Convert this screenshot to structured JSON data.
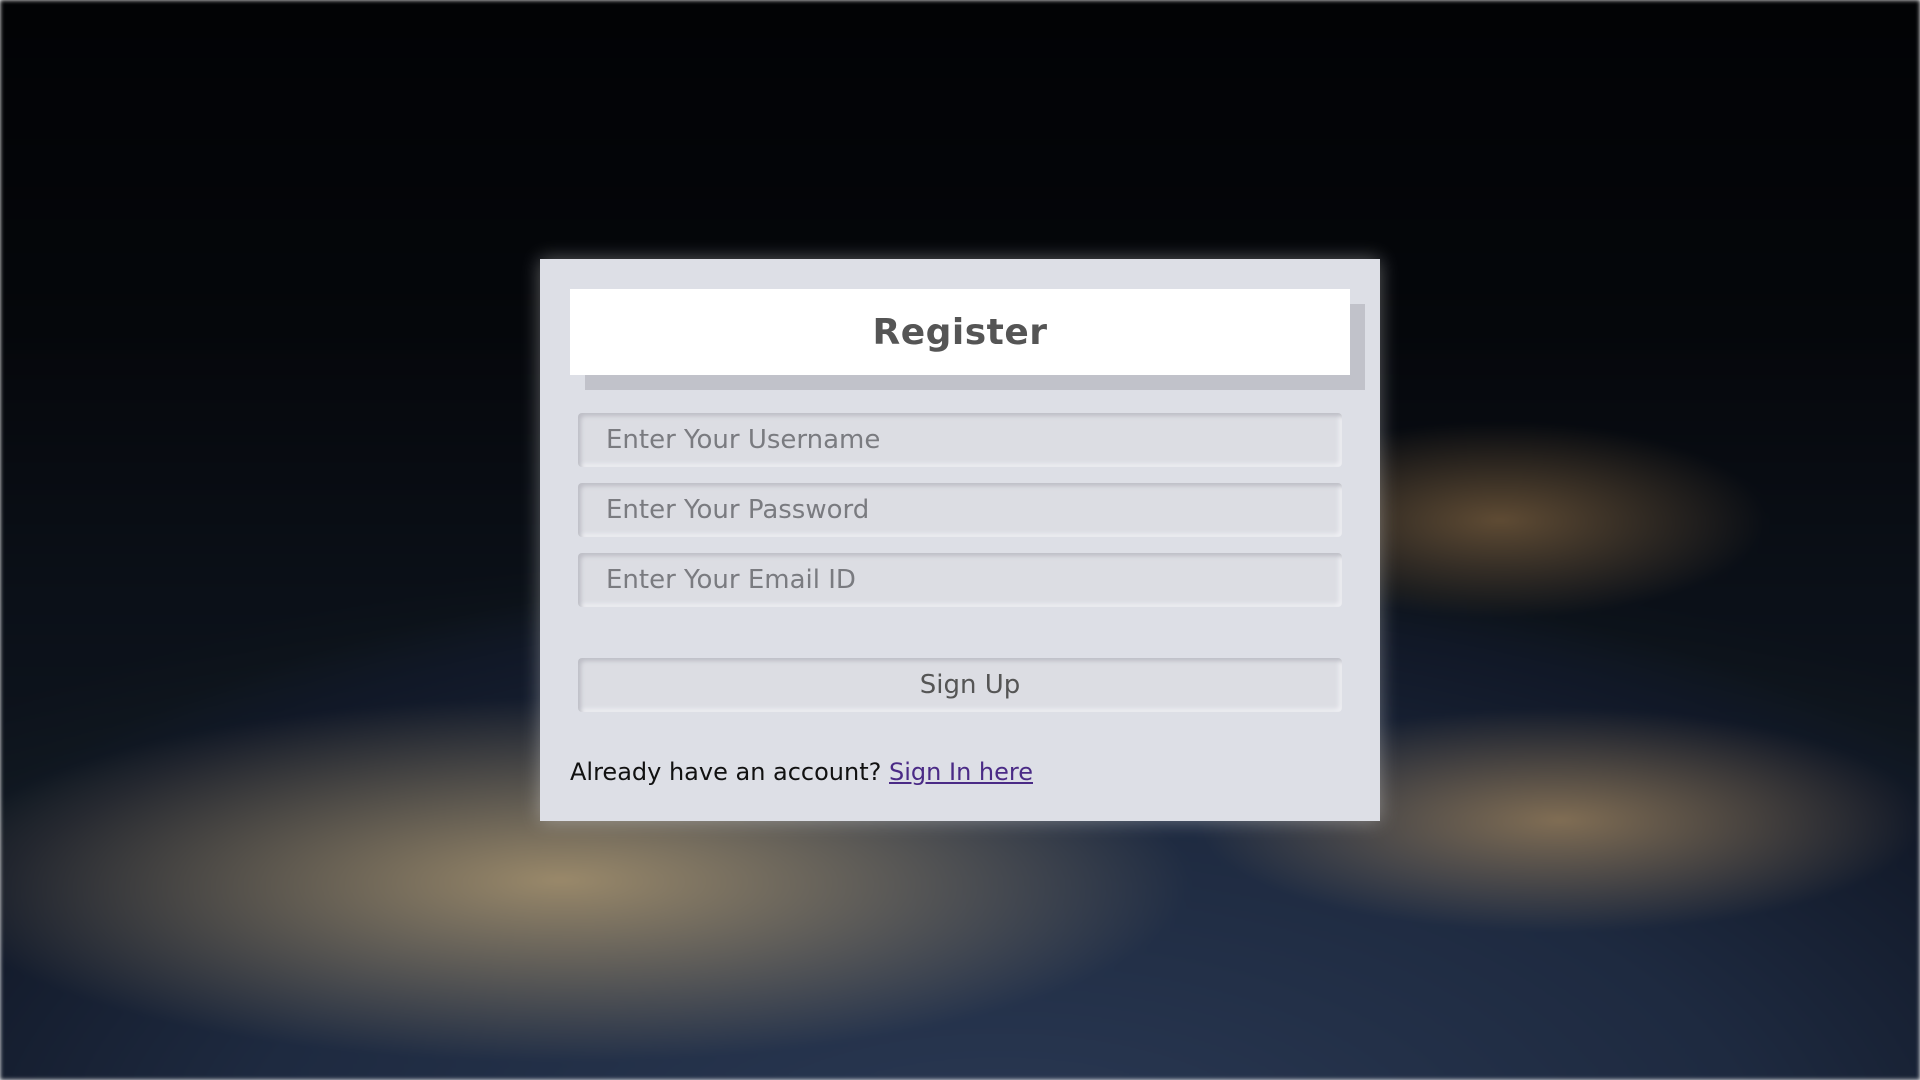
{
  "page": {
    "title": "Register"
  },
  "form": {
    "username_placeholder": "Enter Your Username",
    "password_placeholder": "Enter Your Password",
    "email_placeholder": "Enter Your Email ID",
    "submit_label": "Sign Up"
  },
  "footer": {
    "prompt_text": "Already have an account?",
    "link_text": "Sign In here"
  },
  "colors": {
    "card_background": "#dddfe6",
    "title_background": "#ffffff",
    "title_text": "#555555",
    "link": "#4a2a86"
  }
}
